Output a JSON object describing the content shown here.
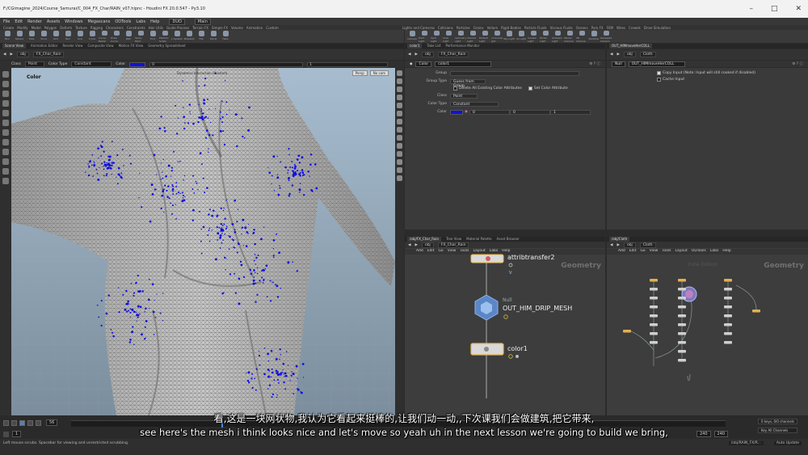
{
  "window": {
    "title": "F:/CGimagine_2024/Course_Samurai/C_004_FX_Char/RAIN_v07.hipnc - Houdini FX 20.0.547 - Py3.10"
  },
  "menubar": {
    "items": [
      "File",
      "Edit",
      "Render",
      "Assets",
      "Windows",
      "Megascans",
      "ODTools",
      "Labs",
      "Help"
    ],
    "build": "DUO",
    "desktop": "Main"
  },
  "shelf_tabs_left": [
    "Create",
    "Modify",
    "Model",
    "Polygon",
    "Deform",
    "Texture",
    "Rigging",
    "Characters",
    "Constraints",
    "Hair Utils",
    "Guide Process",
    "Terrain FX",
    "Simple FX",
    "Volume",
    "Animation",
    "Custom"
  ],
  "shelf_tools_left": [
    "Box",
    "Sphere",
    "Tube",
    "Torus",
    "Grid",
    "Null",
    "Line",
    "Circle",
    "Curve Bezier",
    "Draw Curve",
    "Path",
    "Spray Paint",
    "Font",
    "Platonic Solids",
    "L-System",
    "Metaball",
    "File",
    "Spiral",
    "Helix"
  ],
  "shelf_tabs_right": [
    "Lights and Cameras",
    "Collisions",
    "Particles",
    "Grains",
    "Vellum",
    "Rigid Bodies",
    "Particle Fluids",
    "Viscous Fluids",
    "Oceans",
    "Pyro FX",
    "FEM",
    "Wires",
    "Crowds",
    "Drive Simulation"
  ],
  "shelf_tools_right": [
    "Camera",
    "Point Light",
    "Spot Light",
    "Area Light",
    "Geometry Light",
    "Volume Light",
    "Distant Light",
    "Environment Light",
    "Sky Light",
    "GI Light",
    "Caustic Light",
    "Portal Light",
    "Ambient Light",
    "Stereo Camera",
    "VR Camera",
    "Switcher",
    "Gamepad Camera"
  ],
  "viewport": {
    "tabs": [
      "Scene View",
      "Animation Editor",
      "Render View",
      "Composite View",
      "Motion FX View",
      "Geometry Spreadsheet"
    ],
    "path": [
      "obj",
      "FX_Char_Rain"
    ],
    "options": {
      "class_label": "Class",
      "class_value": "Point",
      "colortype_label": "Color Type",
      "colortype_value": "Constant",
      "color_label": "Color",
      "color_r": "0",
      "color_b": "1"
    },
    "label": "Color",
    "center_label": "Dynamics Interaction (Custom)",
    "cam_buttons": [
      "Persp",
      "No cam"
    ]
  },
  "params": {
    "tabs": [
      "color1",
      "Take List",
      "Performance Monitor"
    ],
    "path": [
      "obj",
      "FX_Char_Rain"
    ],
    "node_type": "Color",
    "node_name": "color1",
    "rows": {
      "group_label": "Group",
      "group_value": "",
      "grouptype_label": "Group Type",
      "grouptype_value": "Guess from Group",
      "delete_label": "Delete All Existing Color Attributes",
      "setcolor_label": "Set Color Attribute",
      "class_label": "Class",
      "class_value": "Point",
      "colortype_label": "Color Type",
      "colortype_value": "Constant",
      "color_label": "Color",
      "color_r": "0",
      "color_g": "0",
      "color_b": "1"
    },
    "swatch_color": "#1010e0"
  },
  "nullpanel": {
    "tabs": [
      "OUT_HIMmoveHerCOLL"
    ],
    "path": [
      "obj",
      "Cloth"
    ],
    "node_type": "Null",
    "node_name": "OUT_HIMmoveHerCOLL",
    "copy_input": "Copy Input (Note: Input will still cooked if disabled)",
    "cache_input": "Cache Input"
  },
  "network_left": {
    "tabs": [
      "/obj/FX_Char_Rain",
      "Tree View",
      "Material Palette",
      "Asset Browser"
    ],
    "path": [
      "obj",
      "FX_Char_Rain"
    ],
    "menu": [
      "Add",
      "Edit",
      "Go",
      "View",
      "Tools",
      "Layout",
      "Labs",
      "Help"
    ],
    "context_label": "Geometry",
    "nodes": {
      "attrib_name": "attribtransfer2",
      "null_type": "Null",
      "null_name": "OUT_HIM_DRIP_MESH",
      "color_name": "color1"
    }
  },
  "network_right": {
    "tabs": [
      "/obj/Cloth"
    ],
    "path": [
      "obj",
      "Cloth"
    ],
    "menu": [
      "Add",
      "Edit",
      "Go",
      "View",
      "Tools",
      "Layout",
      "ODTools",
      "Labs",
      "Help"
    ],
    "context_label": "Geometry",
    "center_label": "Indie Edition"
  },
  "timeline": {
    "frame": "56",
    "start": "1",
    "end_a": "240",
    "end_b": "240",
    "keys": "0 keys, 0/0 channels",
    "key_all": "Key All Channels",
    "auto_update": "Auto Update",
    "path": "/obj/RAIN_FX/R..."
  },
  "status": {
    "hint": "Left mouse scrubs. Spacebar for viewing and unrestricted scrubbing."
  },
  "subtitles": {
    "cn": "看,这是一块网状物,我认为它看起来挺棒的,让我们动一动,,下次课我们会做建筑,把它带来,",
    "en": "see here's the mesh i think looks nice and let's move so yeah uh in the next lesson we're going to build we bring,"
  }
}
